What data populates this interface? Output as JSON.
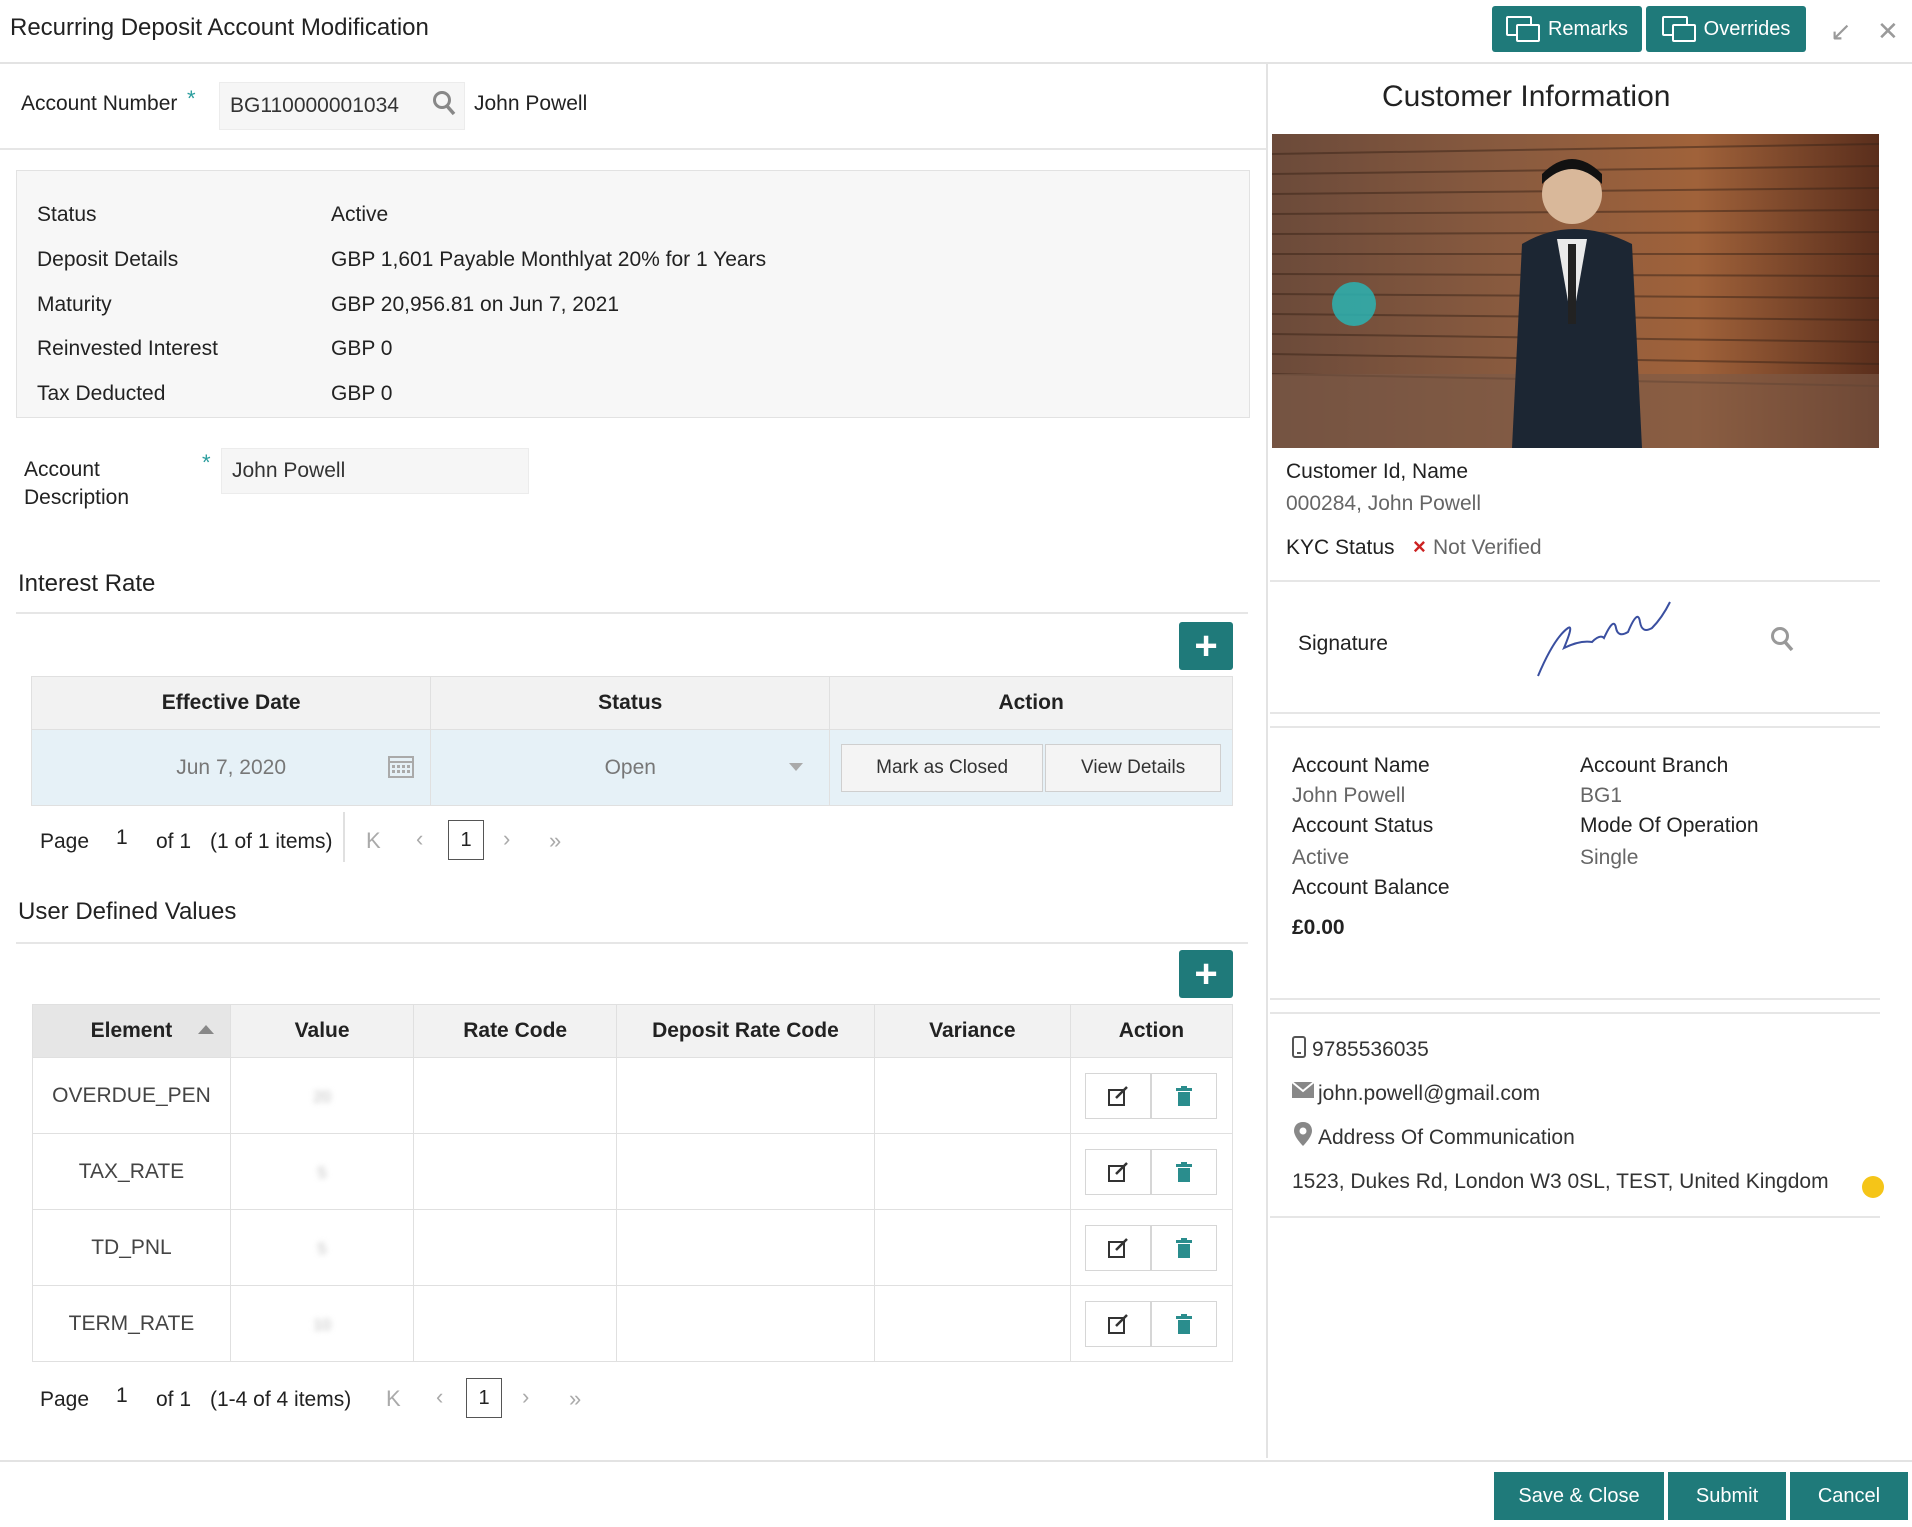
{
  "header": {
    "title": "Recurring Deposit Account Modification",
    "remarks_label": "Remarks",
    "overrides_label": "Overrides",
    "minimize_icon": "↙",
    "close_icon": "✕"
  },
  "account": {
    "number_label": "Account Number",
    "required_mark": "*",
    "number_value": "BG110000001034",
    "holder_name": "John Powell"
  },
  "summary": {
    "rows": [
      {
        "label": "Status",
        "value": "Active"
      },
      {
        "label": "Deposit Details",
        "value": "GBP 1,601 Payable Monthlyat 20% for 1 Years"
      },
      {
        "label": "Maturity",
        "value": "GBP 20,956.81 on Jun 7, 2021"
      },
      {
        "label": "Reinvested Interest",
        "value": "GBP 0"
      },
      {
        "label": "Tax Deducted",
        "value": "GBP 0"
      }
    ]
  },
  "description": {
    "label_line1": "Account",
    "label_line2": "Description",
    "required_mark": "*",
    "value": "John Powell"
  },
  "interest_rate": {
    "title": "Interest Rate",
    "add_icon": "+",
    "columns": [
      "Effective Date",
      "Status",
      "Action"
    ],
    "row": {
      "effective_date": "Jun 7, 2020",
      "status": "Open",
      "mark_closed_label": "Mark as Closed",
      "view_details_label": "View Details"
    },
    "pager": {
      "page_label": "Page",
      "page_value": "1",
      "of_text": "of 1",
      "items_text": "(1 of 1 items)",
      "current": "1"
    }
  },
  "udv": {
    "title": "User Defined Values",
    "add_icon": "+",
    "columns": [
      "Element",
      "Value",
      "Rate Code",
      "Deposit Rate Code",
      "Variance",
      "Action"
    ],
    "rows": [
      {
        "element": "OVERDUE_PEN",
        "value": "20"
      },
      {
        "element": "TAX_RATE",
        "value": "5"
      },
      {
        "element": "TD_PNL",
        "value": "5"
      },
      {
        "element": "TERM_RATE",
        "value": "10"
      }
    ],
    "pager": {
      "page_label": "Page",
      "page_value": "1",
      "of_text": "of 1",
      "items_text": "(1-4 of 4 items)",
      "current": "1"
    }
  },
  "customer": {
    "title": "Customer Information",
    "id_name_label": "Customer Id, Name",
    "id_name_value": "000284, John Powell",
    "kyc_label": "KYC Status",
    "kyc_value": "Not Verified",
    "signature_label": "Signature",
    "account_name_label": "Account Name",
    "account_name_value": "John Powell",
    "account_branch_label": "Account Branch",
    "account_branch_value": "BG1",
    "account_status_label": "Account Status",
    "account_status_value": "Active",
    "mode_label": "Mode Of Operation",
    "mode_value": "Single",
    "balance_label": "Account Balance",
    "balance_value": "£0.00",
    "phone": "9785536035",
    "email": "john.powell@gmail.com",
    "address_label": "Address Of Communication",
    "address_value": "1523, Dukes Rd, London W3 0SL, TEST, United Kingdom"
  },
  "footer": {
    "save_close_label": "Save & Close",
    "submit_label": "Submit",
    "cancel_label": "Cancel"
  },
  "colors": {
    "accent": "#1f7a7a",
    "selected_row": "#e6f1f7",
    "kyc_cross": "#cc2222"
  }
}
